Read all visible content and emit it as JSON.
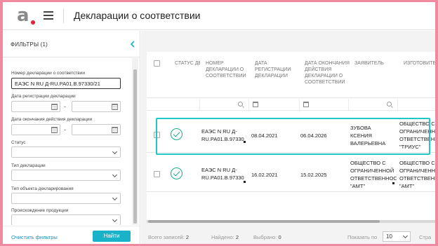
{
  "app": {
    "page_title": "Декларации о соответствии"
  },
  "sidebar": {
    "title": "ФИЛЬТРЫ (1)",
    "fields": {
      "decl_number_label": "Номер декларации о соответствии",
      "decl_number_value": "ЕАЭС N RU Д-RU.PA01.В.97330/21",
      "reg_date_label": "Дата регистрации декларации",
      "end_date_label": "Дата окончания действия декларации",
      "status_label": "Статус",
      "decl_type_label": "Тип декларации",
      "object_type_label": "Тип объекта декларирования",
      "origin_label": "Происхождение продукции"
    },
    "date_separator": "-",
    "clear_label": "Очистить фильтры",
    "find_label": "Найти"
  },
  "table": {
    "columns": [
      "СТАТУС ДЕКЛАРАЦИИ",
      "НОМЕР ДЕКЛАРАЦИИ О СООТВЕТСТВИИ",
      "ДАТА РЕГИСТРАЦИИ ДЕКЛАРАЦИИ",
      "ДАТА ОКОНЧАНИЯ ДЕЙСТВИЯ ДЕКЛАРАЦИИ О СООТВЕТСТВИИ",
      "ЗАЯВИТЕЛЬ",
      "ИЗГОТОВИТЕЛЬ"
    ],
    "rows": [
      {
        "status_icon": "check-circle-icon",
        "number_l1": "ЕАЭС N RU Д-",
        "number_l2": "RU.PA01.В.97330",
        "reg_date": "08.04.2021",
        "end_date": "06.04.2026",
        "applicant_l1": "ЗУБОВА",
        "applicant_l2": "КСЕНИЯ",
        "applicant_l3": "ВАЛЕРЬЕВНА",
        "maker_l1": "ОБЩЕСТВО С",
        "maker_l2": "ОГРАНИЧЕННОЙ",
        "maker_l3": "ОТВЕТСТВЕННОСТЬЮ",
        "maker_l4": "\"ТРИУС\""
      },
      {
        "status_icon": "check-circle-icon",
        "number_l1": "ЕАЭС N RU Д-",
        "number_l2": "RU.PA01.В.97330",
        "reg_date": "16.02.2021",
        "end_date": "15.02.2025",
        "applicant_l1": "ОБЩЕСТВО С",
        "applicant_l2": "ОГРАНИЧЕННОЙ",
        "applicant_l3": "ОТВЕТСТВЕННОСТЬЮ",
        "applicant_l4": "\"АМТ\"",
        "maker_l1": "ОБЩЕСТВО С",
        "maker_l2": "ОГРАНИЧЕННОЙ",
        "maker_l3": "ОТВЕТСТВЕННОСТЬЮ",
        "maker_l4": "\"АМТ\""
      }
    ]
  },
  "footer": {
    "total_label": "Всего записей:",
    "total_value": "2",
    "found_label": "Найдено:",
    "found_value": "2",
    "selected_label": "Выбрано:",
    "selected_value": "0",
    "per_page_label": "Показать по",
    "per_page_value": "10",
    "pages_label": "Стра"
  },
  "colors": {
    "accent": "#19b2c8",
    "highlight": "#1fc7c6",
    "status_ok": "#19a88a",
    "brand_dot": "#e2203a",
    "frame": "#f08aa0"
  }
}
